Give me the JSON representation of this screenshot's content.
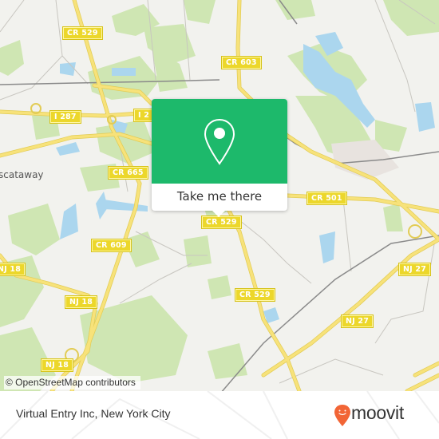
{
  "map": {
    "road_labels": [
      {
        "id": "cr529-north",
        "text": "CR 529"
      },
      {
        "id": "cr603",
        "text": "CR 603"
      },
      {
        "id": "i287-west",
        "text": "I 287"
      },
      {
        "id": "i287-east",
        "text": "I 2"
      },
      {
        "id": "cr665",
        "text": "CR 665"
      },
      {
        "id": "cr501",
        "text": "CR 501"
      },
      {
        "id": "cr529-center",
        "text": "CR 529"
      },
      {
        "id": "cr609",
        "text": "CR 609"
      },
      {
        "id": "nj18-west",
        "text": "NJ 18"
      },
      {
        "id": "nj18-middle",
        "text": "NJ 18"
      },
      {
        "id": "nj18-south",
        "text": "NJ 18"
      },
      {
        "id": "cr529-south",
        "text": "CR 529"
      },
      {
        "id": "nj27-east",
        "text": "NJ 27"
      },
      {
        "id": "nj27-south",
        "text": "NJ 27"
      }
    ],
    "place_labels": [
      {
        "id": "piscataway",
        "text": "scataway"
      }
    ],
    "attribution": "© OpenStreetMap contributors",
    "colors": {
      "land": "#f2f2ee",
      "park": "#cde6b0",
      "water": "#a8d6ef",
      "road_major": "#f5df6a",
      "shield": "#ecd72b"
    }
  },
  "popup": {
    "icon": "location-pin-icon",
    "button_label": "Take me there",
    "accent_color": "#1db96b"
  },
  "footer": {
    "title": "Virtual Entry Inc, New York City",
    "brand": "moovit",
    "brand_color": "#f26536"
  }
}
